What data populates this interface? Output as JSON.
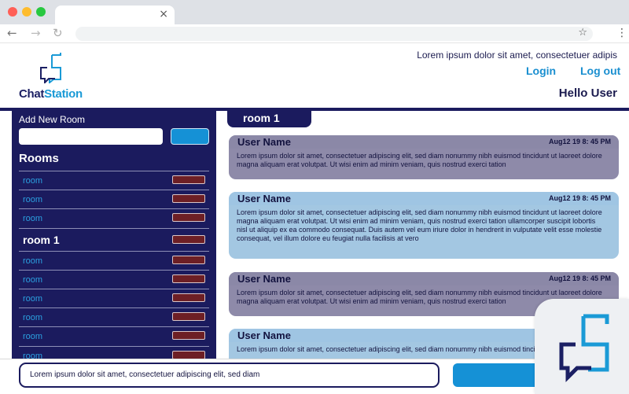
{
  "browser": {
    "tab_close_glyph": "×",
    "back_glyph": "←",
    "forward_glyph": "→",
    "reload_glyph": "↻",
    "star_glyph": "☆",
    "menu_glyph": "⋮"
  },
  "header": {
    "logo_text_1": "Chat",
    "logo_text_2": "Station",
    "tagline": "Lorem ipsum dolor sit amet, consectetuer adipis",
    "login_label": "Login",
    "logout_label": "Log out",
    "greeting": "Hello User"
  },
  "sidebar": {
    "add_room_label": "Add New Room",
    "rooms_title": "Rooms",
    "rooms": [
      {
        "label": "room",
        "active": false
      },
      {
        "label": "room",
        "active": false
      },
      {
        "label": "room",
        "active": false
      },
      {
        "label": "room 1",
        "active": true
      },
      {
        "label": "room",
        "active": false
      },
      {
        "label": "room",
        "active": false
      },
      {
        "label": "room",
        "active": false
      },
      {
        "label": "room",
        "active": false
      },
      {
        "label": "room",
        "active": false
      },
      {
        "label": "room",
        "active": false
      }
    ]
  },
  "chat": {
    "current_room": "room 1",
    "messages": [
      {
        "user": "User Name",
        "time": "Aug12 19 8: 45 PM",
        "text": "Lorem ipsum dolor sit amet, consectetuer adipiscing elit, sed diam nonummy nibh euismod tincidunt ut laoreet dolore magna aliquam erat volutpat. Ut wisi enim ad minim veniam, quis nostrud exerci tation",
        "style": "gray"
      },
      {
        "user": "User Name",
        "time": "Aug12 19 8: 45 PM",
        "text": "Lorem ipsum dolor sit amet, consectetuer adipiscing elit, sed diam nonummy nibh euismod tincidunt ut laoreet dolore magna aliquam erat volutpat. Ut wisi enim ad minim veniam, quis nostrud exerci tation ullamcorper suscipit lobortis nisl ut aliquip ex ea commodo consequat. Duis autem vel eum iriure dolor in hendrerit in vulputate velit esse molestie consequat, vel illum dolore eu feugiat nulla facilisis at vero",
        "style": "blue"
      },
      {
        "user": "User Name",
        "time": "Aug12 19 8: 45 PM",
        "text": "Lorem ipsum dolor sit amet, consectetuer adipiscing elit, sed diam nonummy nibh euismod tincidunt ut laoreet dolore magna aliquam erat volutpat. Ut wisi enim ad minim veniam, quis nostrud exerci tation",
        "style": "gray"
      },
      {
        "user": "User Name",
        "time": "Aug12 19 8: 45 PM",
        "text": "Lorem ipsum dolor sit amet, consectetuer adipiscing elit, sed diam nonummy nibh euismod tincidunt ut laoreet",
        "style": "blue"
      }
    ]
  },
  "compose": {
    "value": "Lorem ipsum dolor sit amet, consectetuer adipiscing elit, sed diam"
  },
  "colors": {
    "navy": "#1b1b5e",
    "accent_blue": "#1591d6",
    "message_gray": "#8e8aa9",
    "message_blue": "#a3c7e2",
    "delete_red": "#6d1f25"
  }
}
